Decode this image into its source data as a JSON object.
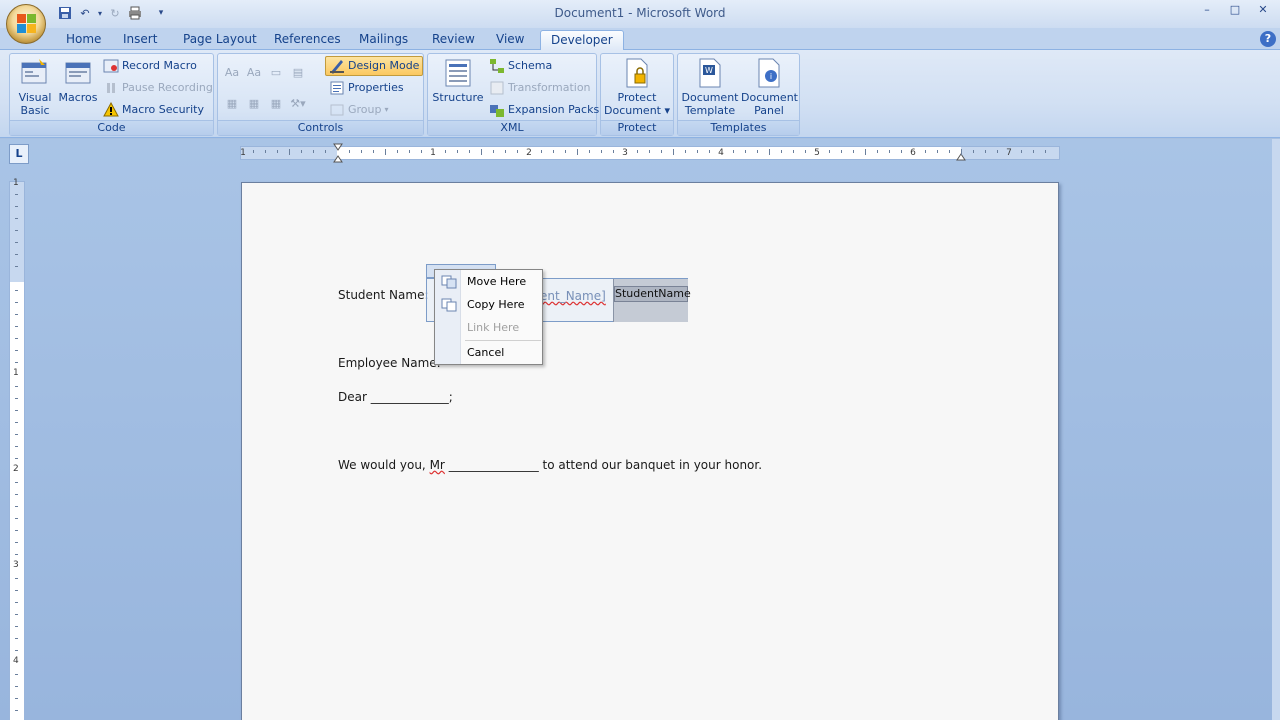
{
  "window": {
    "title": "Document1 - Microsoft Word",
    "controls": [
      "–",
      "□",
      "✕"
    ]
  },
  "tabs": [
    {
      "label": "Home"
    },
    {
      "label": "Insert"
    },
    {
      "label": "Page Layout"
    },
    {
      "label": "References"
    },
    {
      "label": "Mailings"
    },
    {
      "label": "Review"
    },
    {
      "label": "View"
    },
    {
      "label": "Developer",
      "active": true
    }
  ],
  "ribbon": {
    "code": {
      "label": "Code",
      "visual_basic": "Visual Basic",
      "macros": "Macros",
      "record_macro": "Record Macro",
      "pause_recording": "Pause Recording",
      "macro_security": "Macro Security"
    },
    "controls": {
      "label": "Controls",
      "design_mode": "Design Mode",
      "properties": "Properties",
      "group": "Group"
    },
    "xml": {
      "label": "XML",
      "structure": "Structure",
      "schema": "Schema",
      "transformation": "Transformation",
      "expansion_packs": "Expansion Packs"
    },
    "protect": {
      "label": "Protect",
      "protect_document": "Protect Document ▾"
    },
    "templates": {
      "label": "Templates",
      "document_template": "Document Template",
      "document_panel": "Document Panel"
    }
  },
  "ruler": {
    "numbers": [
      "1",
      "1",
      "2",
      "3",
      "4",
      "5",
      "6",
      "7"
    ],
    "vnumbers": [
      "1",
      "1",
      "2",
      "3",
      "4"
    ],
    "corner": "L"
  },
  "document": {
    "student_name_label": "Student Name:",
    "cc_placeholder": "ent_Name]",
    "cc_xml_tag": "StudentName",
    "employee_name_label": "Employee Name:",
    "dear_line": "Dear _____________;",
    "body_prefix": "We would you, ",
    "body_mr": "Mr",
    "body_suffix": " _______________ to attend our banquet in your honor."
  },
  "context_menu": {
    "items": [
      {
        "label": "Move Here",
        "enabled": true
      },
      {
        "label": "Copy Here",
        "enabled": true
      },
      {
        "label": "Link Here",
        "enabled": false
      },
      {
        "label": "Cancel",
        "enabled": true
      }
    ]
  },
  "colors": {
    "accent_active": "#fbc860",
    "ribbon_text": "#15428b"
  }
}
